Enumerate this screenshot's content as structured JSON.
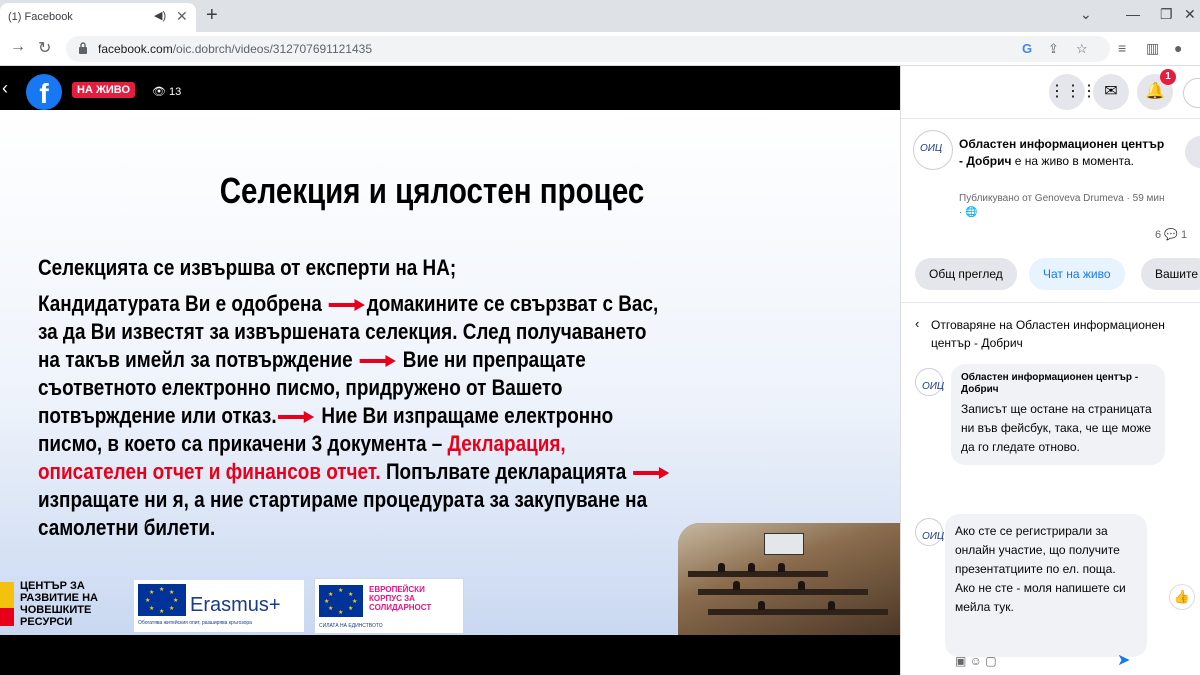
{
  "browser": {
    "tab_title": "(1) Facebook",
    "url_host": "facebook.com",
    "url_path": "/oic.dobrch/videos/312707691121435",
    "icons": [
      "back-icon",
      "forward-icon",
      "reload-icon",
      "lock-icon",
      "google-icon",
      "share-icon",
      "star-icon",
      "menu-icon",
      "sidepanel-icon",
      "profile-icon"
    ]
  },
  "video": {
    "live_label": "НА ЖИВО",
    "viewer_count": "13",
    "slide": {
      "title": "Селекция и цялостен процес",
      "lines": [
        "Селекцията се извършва от експерти на НА;",
        "Кандидатурата Ви е одобрена",
        "домакините се свързват с Вас,",
        "за да Ви известят за извършената селекция.  След получаването",
        "на такъв имейл за потвърждение",
        "Вие ни препращате",
        "съответното електронно писмо, придружено от Вашето",
        "потвърждение или отказ.",
        "Ние Ви изпращаме електронно",
        "писмо, в което са прикачени 3 документа –",
        "Декларация,",
        "описателен отчет и финансов отчет.",
        "Попълвате декларацията",
        "изпращате ни я, а ние стартираме процедурата за закупуване на",
        "самолетни билети."
      ],
      "logos": {
        "crc": "ЦЕНТЪР ЗА РАЗВИТИЕ НА ЧОВЕШКИТЕ РЕСУРСИ",
        "erasmus": "Erasmus+",
        "erasmus_sub": "Обогатява житейския опит, разширява кръгозора",
        "esc": "ЕВРОПЕЙСКИ КОРПУС ЗА СОЛИДАРНОСТ",
        "esc_sub": "СИЛАТА НА ЕДИНСТВОТО"
      }
    }
  },
  "panel": {
    "notification_count": "1",
    "post": {
      "author": "Областен информационен център - Добрич",
      "status": " е на живо в момента.",
      "published_by": "Публикувано от Genoveva Drumeva",
      "time": "59 мин",
      "comment_count": "6",
      "share_count": "1"
    },
    "tabs": [
      "Общ преглед",
      "Чат на живо",
      "Вашите"
    ],
    "reply_header": "Отговаряне на Областен информационен център - Добрич",
    "comments": [
      {
        "author": "Областен информационен център - Добрич",
        "text": "Записът ще остане на страницата ни във фейсбук, така, че ще може да го гледате отново."
      },
      {
        "text": "Ако сте  се регистрирали за онлайн участие, що получите презентатциите по ел. поща. Ако не сте - моля напишете си мейла тук."
      }
    ]
  }
}
